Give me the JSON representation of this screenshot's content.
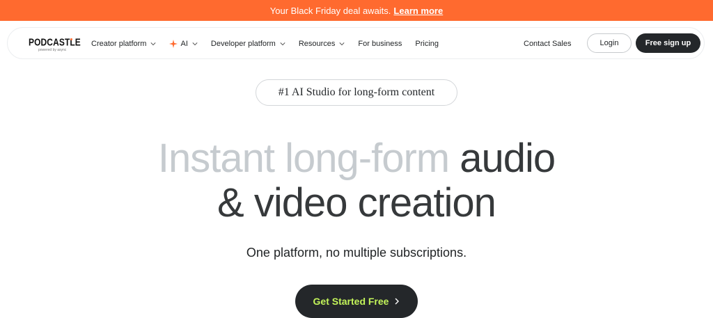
{
  "banner": {
    "text": "Your Black Friday deal awaits.",
    "link": "Learn more"
  },
  "logo": {
    "word": "PODCASTLE",
    "sub": "powered by async"
  },
  "nav": {
    "items": [
      {
        "label": "Creator platform",
        "chevron": true
      },
      {
        "label": "AI",
        "chevron": true,
        "icon": "sparkle-icon"
      },
      {
        "label": "Developer platform",
        "chevron": true
      },
      {
        "label": "Resources",
        "chevron": true
      },
      {
        "label": "For business",
        "chevron": false
      },
      {
        "label": "Pricing",
        "chevron": false
      }
    ],
    "contact": "Contact Sales",
    "login": "Login",
    "signup": "Free sign up"
  },
  "hero": {
    "pill": "#1 AI Studio for long-form content",
    "line1_muted": "Instant long-form",
    "line1_dark": "audio",
    "line2": "& video creation",
    "subtitle": "One platform, no multiple subscriptions.",
    "cta": "Get Started Free"
  },
  "colors": {
    "banner": "#ff6a2f",
    "dark": "#24272a",
    "cta_text": "#c3f45a",
    "muted_heading": "#c6cbcf"
  }
}
